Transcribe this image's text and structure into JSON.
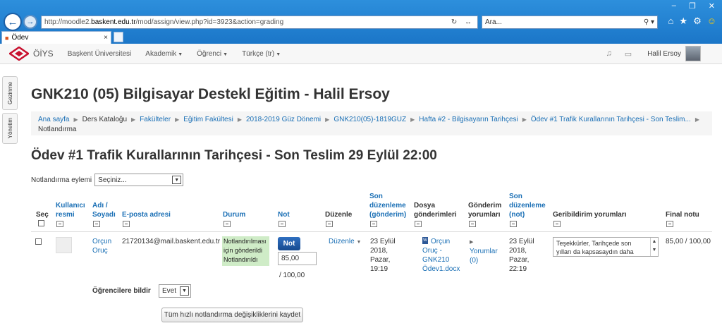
{
  "browser": {
    "url_prefix": "http://moodle2.",
    "url_domain": "baskent.edu.tr",
    "url_path": "/mod/assign/view.php?id=3923&action=grading",
    "search_placeholder": "Ara...",
    "tab_title": "Ödev"
  },
  "navbar": {
    "brand": "ÖİYS",
    "items": [
      "Başkent Üniversitesi",
      "Akademik",
      "Öğrenci",
      "Türkçe (tr)"
    ],
    "user_name": "Halil Ersoy"
  },
  "side_tabs": [
    "Gezinme",
    "Yönetim"
  ],
  "page_title": "GNK210 (05) Bilgisayar Destekl Eğitim - Halil Ersoy",
  "breadcrumb": [
    "Ana sayfa",
    "Ders Kataloğu",
    "Fakülteler",
    "Eğitim Fakültesi",
    "2018-2019 Güz Dönemi",
    "GNK210(05)-1819GUZ",
    "Hafta #2 - Bilgisayarın Tarihçesi",
    "Ödev #1 Trafik Kurallarının Tarihçesi - Son Teslim...",
    "Notlandırma"
  ],
  "assignment_title": "Ödev #1 Trafik Kurallarının Tarihçesi - Son Teslim 29 Eylül 22:00",
  "grading_action": {
    "label": "Notlandırma eylemi",
    "selected": "Seçiniz..."
  },
  "table": {
    "headers": {
      "select": "Seç",
      "user_picture": [
        "Kullanıcı",
        "resmi"
      ],
      "name": [
        "Adı /",
        "Soyadı"
      ],
      "email": "E-posta adresi",
      "status": "Durum",
      "grade": "Not",
      "edit": "Düzenle",
      "last_modified_submission": [
        "Son",
        "düzenleme",
        "(gönderim)"
      ],
      "file_submissions": [
        "Dosya",
        "gönderimleri"
      ],
      "submission_comments": [
        "Gönderim",
        "yorumları"
      ],
      "last_modified_grade": [
        "Son",
        "düzenleme",
        "(not)"
      ],
      "feedback_comments": "Geribildirim yorumları",
      "final_grade": "Final notu"
    },
    "row": {
      "name": [
        "Orçun",
        "Oruç"
      ],
      "email": "21720134@mail.baskent.edu.tr",
      "status": [
        "Notlandırılması",
        "için gönderildi",
        "Notlandırıldı"
      ],
      "grade_button": "Not",
      "grade_value": "85,00",
      "grade_max": "/ 100,00",
      "edit_label": "Düzenle",
      "submission_date": [
        "23 Eylül",
        "2018,",
        "Pazar,",
        "19:19"
      ],
      "file": [
        "Orçun",
        "Oruç -",
        "GNK210",
        "Ödev1.docx"
      ],
      "comments": [
        "Yorumlar",
        "(0)"
      ],
      "grade_date": [
        "23 Eylül",
        "2018,",
        "Pazar,",
        "22:19"
      ],
      "feedback": [
        "Teşekkürler, Tarihçede son",
        "yılları da kapsasaydın daha"
      ],
      "final_grade": "85,00 / 100,00"
    }
  },
  "notify": {
    "label": "Öğrencilere bildir",
    "value": "Evet"
  },
  "save_button": "Tüm hızlı notlandırma değişikliklerini kaydet"
}
